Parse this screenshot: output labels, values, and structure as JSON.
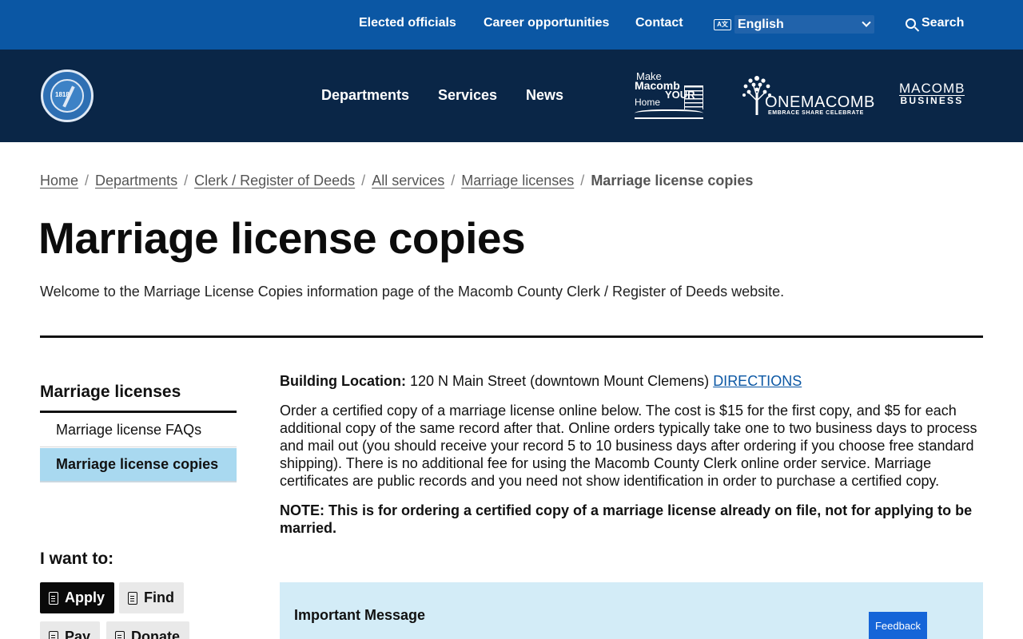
{
  "utility_bar": {
    "links": [
      "Elected officials",
      "Career opportunities",
      "Contact"
    ],
    "language_icon": "A文",
    "language_value": "English",
    "search_label": "Search"
  },
  "header": {
    "seal_year": "1818",
    "nav": [
      "Departments",
      "Services",
      "News"
    ],
    "logo_make": {
      "line1": "Make",
      "line2": "Macomb",
      "line3": "YOUR",
      "line4": "Home"
    },
    "logo_one": {
      "name": "ONEMACOMB",
      "tagline": "EMBRACE SHARE CELEBRATE"
    },
    "logo_business": {
      "line1": "MACOMB",
      "line2": "BUSINESS"
    }
  },
  "breadcrumb": {
    "links": [
      "Home",
      "Departments",
      "Clerk / Register of Deeds",
      "All services",
      "Marriage licenses"
    ],
    "current": "Marriage license copies",
    "separator": "/"
  },
  "page": {
    "title": "Marriage license copies",
    "intro": "Welcome to the Marriage License Copies information page of the Macomb County Clerk / Register of Deeds website."
  },
  "sidebar": {
    "heading": "Marriage licenses",
    "items": [
      "Marriage license FAQs",
      "Marriage license copies"
    ],
    "active_index": 1,
    "want_heading": "I want to:",
    "actions": [
      "Apply",
      "Find",
      "Pay",
      "Donate"
    ]
  },
  "content": {
    "location_label": "Building Location:",
    "location_value": "120 N Main Street (downtown Mount Clemens)",
    "directions_label": "DIRECTIONS",
    "paragraph": "Order a certified copy of a marriage license online below. The cost is $15 for the first copy, and $5 for each additional copy of the same record after that. Online orders typically take one to two business days to process and mail out (you should receive your record 5 to 10 business days after ordering if you choose free standard shipping). There is no additional fee for using the Macomb County Clerk online order service. Marriage certificates are public records and you need not show identification in order to purchase a certified copy.",
    "note": "NOTE: This is for ordering a certified copy of a marriage license already on file, not for applying to be married.",
    "message_title": "Important Message"
  },
  "feedback_label": "Feedback",
  "colors": {
    "utility_bar": "#0b57a4",
    "header": "#0a2647",
    "active_sidebar": "#a9d9f0",
    "message_box": "#d3ecf7",
    "feedback": "#1565d8"
  }
}
